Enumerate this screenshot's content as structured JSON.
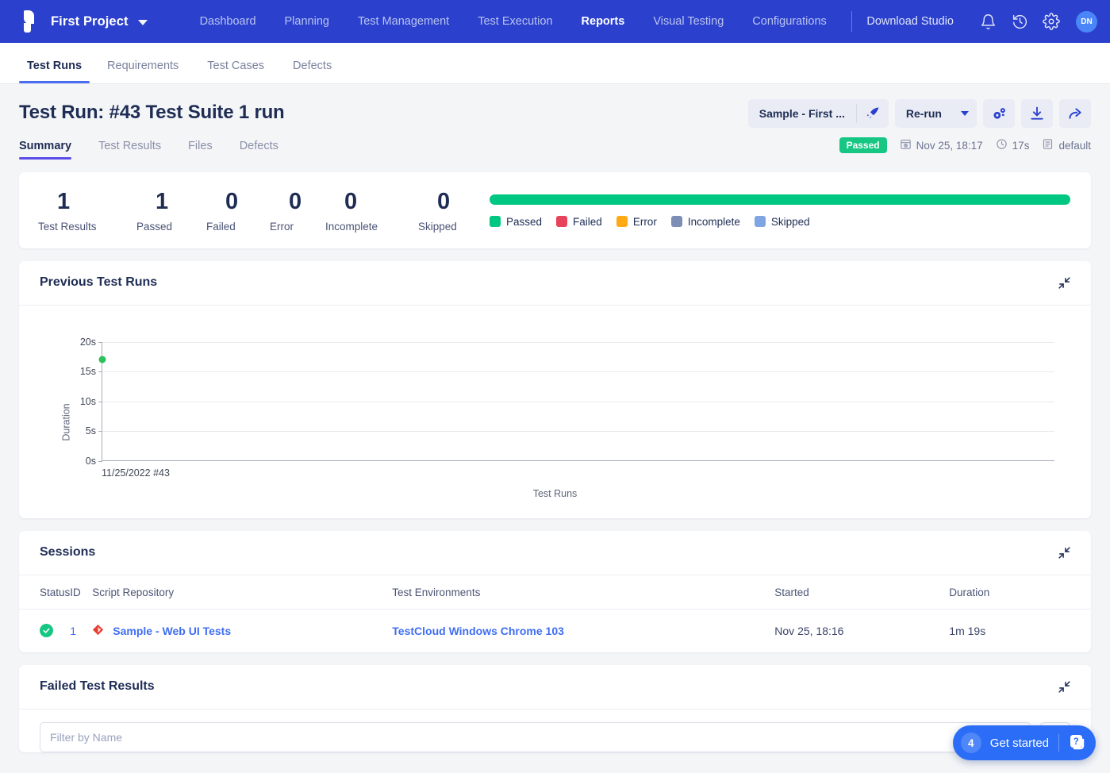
{
  "topbar": {
    "project": "First Project",
    "logo_icon": "katalon-logo-icon",
    "project_chevron_icon": "chevron-down-icon",
    "nav": [
      {
        "label": "Dashboard",
        "active": false
      },
      {
        "label": "Planning",
        "active": false
      },
      {
        "label": "Test Management",
        "active": false
      },
      {
        "label": "Test Execution",
        "active": false
      },
      {
        "label": "Reports",
        "active": true
      },
      {
        "label": "Visual Testing",
        "active": false
      },
      {
        "label": "Configurations",
        "active": false
      }
    ],
    "download_studio": "Download Studio",
    "icons": [
      "bell-icon",
      "history-icon",
      "gear-icon"
    ],
    "avatar_initials": "DN"
  },
  "subnav": {
    "items": [
      {
        "label": "Test Runs",
        "active": true
      },
      {
        "label": "Requirements",
        "active": false
      },
      {
        "label": "Test Cases",
        "active": false
      },
      {
        "label": "Defects",
        "active": false
      }
    ]
  },
  "page": {
    "title": "Test Run: #43 Test Suite 1 run",
    "actions": {
      "profile_label": "Sample - First ...",
      "run_icon": "rocket-icon",
      "rerun_label": "Re-run",
      "rerun_caret_icon": "caret-down-icon",
      "settings_icon": "gears-icon",
      "download_icon": "download-icon",
      "share_icon": "share-arrow-icon"
    },
    "tabs": [
      {
        "label": "Summary",
        "active": true
      },
      {
        "label": "Test Results",
        "active": false
      },
      {
        "label": "Files",
        "active": false
      },
      {
        "label": "Defects",
        "active": false
      }
    ],
    "meta": {
      "status_badge": "Passed",
      "date_icon": "calendar-clock-icon",
      "date": "Nov 25, 18:17",
      "duration_icon": "clock-icon",
      "duration": "17s",
      "profile_icon": "list-icon",
      "profile": "default"
    }
  },
  "stats": {
    "items": [
      {
        "value": "1",
        "label": "Test Results"
      },
      {
        "value": "1",
        "label": "Passed"
      },
      {
        "value": "0",
        "label": "Failed"
      },
      {
        "value": "0",
        "label": "Error"
      },
      {
        "value": "0",
        "label": "Incomplete"
      },
      {
        "value": "0",
        "label": "Skipped"
      }
    ],
    "progress": [
      {
        "label": "Passed",
        "percent": 100,
        "color": "#00c781"
      }
    ],
    "legend": [
      {
        "label": "Passed",
        "color": "#00c781"
      },
      {
        "label": "Failed",
        "color": "#e8435a"
      },
      {
        "label": "Error",
        "color": "#ffaa15"
      },
      {
        "label": "Incomplete",
        "color": "#7d8db3"
      },
      {
        "label": "Skipped",
        "color": "#7fa5e3"
      }
    ]
  },
  "previous_runs": {
    "title": "Previous Test Runs",
    "collapse_icon": "collapse-icon"
  },
  "chart_data": {
    "type": "scatter",
    "title": "Previous Test Runs",
    "xlabel": "Test Runs",
    "ylabel": "Duration",
    "categories": [
      "11/25/2022 #43"
    ],
    "values": [
      17
    ],
    "yticks": [
      "0s",
      "5s",
      "10s",
      "15s",
      "20s"
    ],
    "ytick_values": [
      0,
      5,
      10,
      15,
      20
    ],
    "ylim": [
      0,
      20
    ],
    "grid": true,
    "legend": "none",
    "point_color": "#2fbf5f",
    "series": [
      {
        "name": "Duration",
        "values": [
          17
        ]
      }
    ]
  },
  "sessions": {
    "title": "Sessions",
    "collapse_icon": "collapse-icon",
    "columns": [
      "Status",
      "ID",
      "Script Repository",
      "Test Environments",
      "Started",
      "Duration"
    ],
    "rows": [
      {
        "status_icon": "check-circle-icon",
        "id": "1",
        "repo_icon": "git-repo-icon",
        "repo": "Sample - Web UI Tests",
        "environment": "TestCloud Windows Chrome 103",
        "started": "Nov 25, 18:16",
        "duration": "1m 19s"
      }
    ]
  },
  "failed_results": {
    "title": "Failed Test Results",
    "collapse_icon": "collapse-icon",
    "filter_placeholder": "Filter by Name",
    "filter_value": "",
    "columns_icon": "columns-icon"
  },
  "get_started": {
    "count": "4",
    "label": "Get started",
    "help_icon": "help-question-icon"
  }
}
